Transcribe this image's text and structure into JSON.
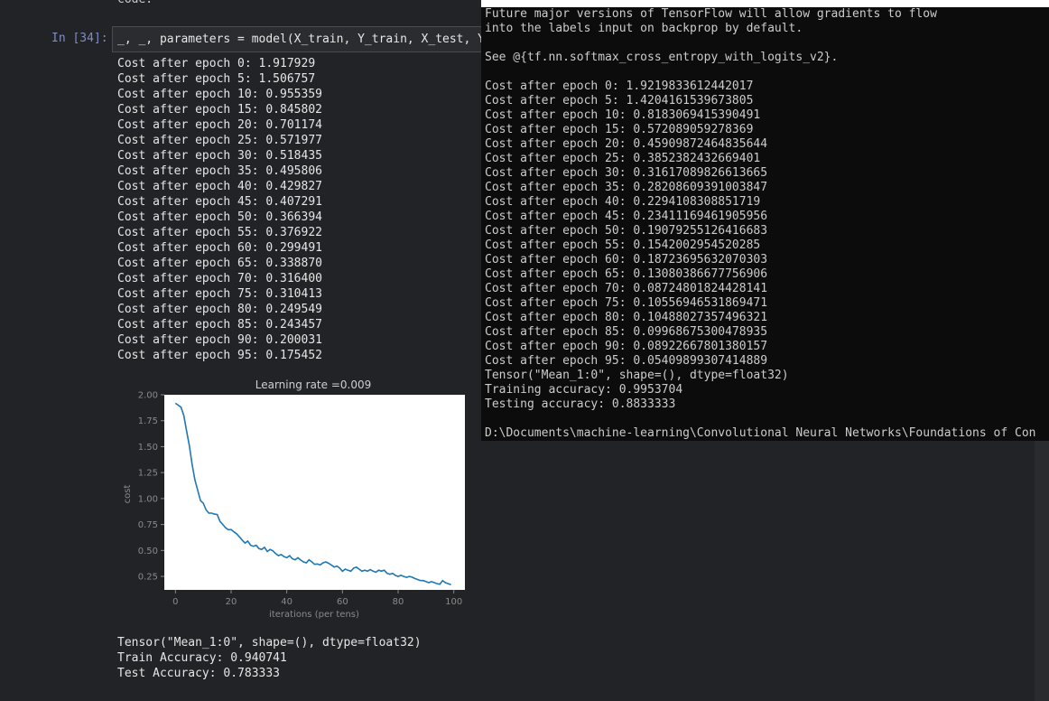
{
  "notebook": {
    "prev_text": "code.",
    "cell": {
      "prompt": "In [34]:",
      "code": "_, _, parameters = model(X_train, Y_train, X_test, Y_"
    },
    "cost_lines": [
      "Cost after epoch 0: 1.917929",
      "Cost after epoch 5: 1.506757",
      "Cost after epoch 10: 0.955359",
      "Cost after epoch 15: 0.845802",
      "Cost after epoch 20: 0.701174",
      "Cost after epoch 25: 0.571977",
      "Cost after epoch 30: 0.518435",
      "Cost after epoch 35: 0.495806",
      "Cost after epoch 40: 0.429827",
      "Cost after epoch 45: 0.407291",
      "Cost after epoch 50: 0.366394",
      "Cost after epoch 55: 0.376922",
      "Cost after epoch 60: 0.299491",
      "Cost after epoch 65: 0.338870",
      "Cost after epoch 70: 0.316400",
      "Cost after epoch 75: 0.310413",
      "Cost after epoch 80: 0.249549",
      "Cost after epoch 85: 0.243457",
      "Cost after epoch 90: 0.200031",
      "Cost after epoch 95: 0.175452"
    ],
    "result_lines": [
      "Tensor(\"Mean_1:0\", shape=(), dtype=float32)",
      "Train Accuracy: 0.940741",
      "Test Accuracy: 0.783333"
    ]
  },
  "terminal": {
    "lines": [
      "Future major versions of TensorFlow will allow gradients to flow",
      "into the labels input on backprop by default.",
      "",
      "See @{tf.nn.softmax_cross_entropy_with_logits_v2}.",
      "",
      "Cost after epoch 0: 1.9219833612442017",
      "Cost after epoch 5: 1.4204161539673805",
      "Cost after epoch 10: 0.8183069415390491",
      "Cost after epoch 15: 0.572089059278369",
      "Cost after epoch 20: 0.45909872464835644",
      "Cost after epoch 25: 0.3852382432669401",
      "Cost after epoch 30: 0.31617089826613665",
      "Cost after epoch 35: 0.28208609391003847",
      "Cost after epoch 40: 0.2294108308851719",
      "Cost after epoch 45: 0.23411169461905956",
      "Cost after epoch 50: 0.19079255126416683",
      "Cost after epoch 55: 0.1542002954520285",
      "Cost after epoch 60: 0.18723695632070303",
      "Cost after epoch 65: 0.13080386677756906",
      "Cost after epoch 70: 0.08724801824428141",
      "Cost after epoch 75: 0.10556946531869471",
      "Cost after epoch 80: 0.10488027357496321",
      "Cost after epoch 85: 0.09968675300478935",
      "Cost after epoch 90: 0.08922667801380157",
      "Cost after epoch 95: 0.05409899307414889",
      "Tensor(\"Mean_1:0\", shape=(), dtype=float32)",
      "Training accuracy: 0.9953704",
      "Testing accuracy: 0.8833333",
      "",
      "D:\\Documents\\machine-learning\\Convolutional Neural Networks\\Foundations of Con"
    ]
  },
  "chart_data": {
    "type": "line",
    "title": "Learning rate =0.009",
    "xlabel": "iterations (per tens)",
    "ylabel": "cost",
    "xlim": [
      -4,
      104
    ],
    "ylim": [
      0.12,
      2.0
    ],
    "xticks": [
      "0",
      "20",
      "40",
      "60",
      "80",
      "100"
    ],
    "yticks": [
      "0.25",
      "0.50",
      "0.75",
      "1.00",
      "1.25",
      "1.50",
      "1.75",
      "2.00"
    ],
    "series": [
      {
        "color": "#1f77b4",
        "x": [
          0,
          1,
          2,
          3,
          4,
          5,
          6,
          7,
          8,
          9,
          10,
          11,
          12,
          13,
          14,
          15,
          16,
          17,
          18,
          19,
          20,
          21,
          22,
          23,
          24,
          25,
          26,
          27,
          28,
          29,
          30,
          31,
          32,
          33,
          34,
          35,
          36,
          37,
          38,
          39,
          40,
          41,
          42,
          43,
          44,
          45,
          46,
          47,
          48,
          49,
          50,
          51,
          52,
          53,
          54,
          55,
          56,
          57,
          58,
          59,
          60,
          61,
          62,
          63,
          64,
          65,
          66,
          67,
          68,
          69,
          70,
          71,
          72,
          73,
          74,
          75,
          76,
          77,
          78,
          79,
          80,
          81,
          82,
          83,
          84,
          85,
          86,
          87,
          88,
          89,
          90,
          91,
          92,
          93,
          94,
          95,
          96,
          97,
          98,
          99
        ],
        "values": [
          1.918,
          1.9,
          1.88,
          1.8,
          1.65,
          1.507,
          1.33,
          1.18,
          1.08,
          0.98,
          0.955,
          0.89,
          0.86,
          0.86,
          0.85,
          0.846,
          0.78,
          0.75,
          0.72,
          0.7,
          0.701,
          0.68,
          0.66,
          0.63,
          0.6,
          0.572,
          0.59,
          0.55,
          0.54,
          0.55,
          0.518,
          0.51,
          0.53,
          0.49,
          0.51,
          0.496,
          0.47,
          0.45,
          0.46,
          0.44,
          0.43,
          0.45,
          0.42,
          0.41,
          0.43,
          0.407,
          0.39,
          0.38,
          0.41,
          0.39,
          0.366,
          0.37,
          0.36,
          0.38,
          0.39,
          0.377,
          0.36,
          0.34,
          0.35,
          0.33,
          0.299,
          0.32,
          0.31,
          0.3,
          0.33,
          0.339,
          0.32,
          0.3,
          0.31,
          0.3,
          0.316,
          0.3,
          0.29,
          0.31,
          0.3,
          0.31,
          0.28,
          0.27,
          0.28,
          0.26,
          0.25,
          0.26,
          0.25,
          0.24,
          0.25,
          0.243,
          0.23,
          0.22,
          0.21,
          0.21,
          0.2,
          0.19,
          0.2,
          0.19,
          0.18,
          0.175,
          0.21,
          0.19,
          0.18,
          0.17
        ]
      }
    ],
    "grid": false,
    "background": "#ffffff"
  },
  "colors": {
    "notebook_bg": "#222326",
    "prompt": "#7f8cc4",
    "terminal_bg": "#0c0c0c",
    "terminal_text": "#cccccc",
    "line": "#1f77b4"
  }
}
